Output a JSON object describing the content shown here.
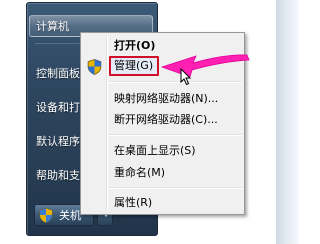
{
  "start_pane": {
    "items": [
      {
        "label": "计算机"
      },
      {
        "label": "控制面板"
      },
      {
        "label": "设备和打"
      },
      {
        "label": "默认程序"
      },
      {
        "label": "帮助和支"
      }
    ],
    "shutdown_label": "关机"
  },
  "context_menu": {
    "items": [
      {
        "label": "打开(O)"
      },
      {
        "label": "管理(G)"
      },
      {
        "label": "映射网络驱动器(N)..."
      },
      {
        "label": "断开网络驱动器(C)..."
      },
      {
        "label": "在桌面上显示(S)"
      },
      {
        "label": "重命名(M)"
      },
      {
        "label": "属性(R)"
      }
    ]
  },
  "colors": {
    "highlight_border": "#d0102a",
    "arrow": "#ff1fb0"
  },
  "icons": {
    "manage": "uac-shield-icon",
    "shutdown": "uac-shield-icon",
    "arrow": "pink-pointer-arrow",
    "cursor": "mouse-cursor-icon"
  }
}
